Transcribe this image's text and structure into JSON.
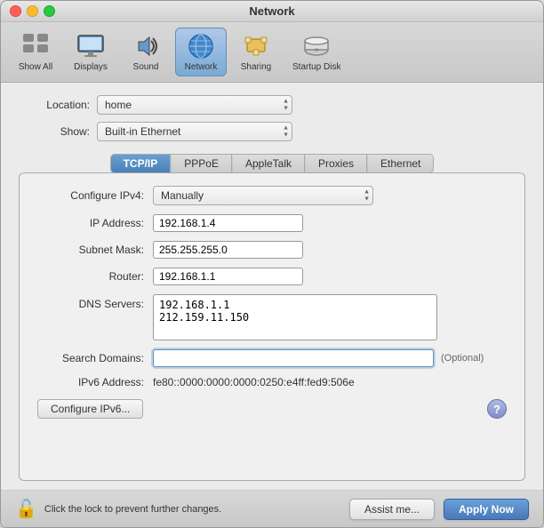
{
  "window": {
    "title": "Network"
  },
  "toolbar": {
    "items": [
      {
        "id": "show-all",
        "label": "Show All",
        "icon": "⊞"
      },
      {
        "id": "displays",
        "label": "Displays",
        "icon": "🖥"
      },
      {
        "id": "sound",
        "label": "Sound",
        "icon": "🔊"
      },
      {
        "id": "network",
        "label": "Network",
        "icon": "🌐",
        "active": true
      },
      {
        "id": "sharing",
        "label": "Sharing",
        "icon": "🤝"
      },
      {
        "id": "startup-disk",
        "label": "Startup Disk",
        "icon": "💿"
      }
    ]
  },
  "form": {
    "location_label": "Location:",
    "location_value": "home",
    "show_label": "Show:",
    "show_value": "Built-in Ethernet"
  },
  "tabs": [
    {
      "id": "tcp-ip",
      "label": "TCP/IP",
      "active": true
    },
    {
      "id": "pppoe",
      "label": "PPPoE",
      "active": false
    },
    {
      "id": "appletalk",
      "label": "AppleTalk",
      "active": false
    },
    {
      "id": "proxies",
      "label": "Proxies",
      "active": false
    },
    {
      "id": "ethernet",
      "label": "Ethernet",
      "active": false
    }
  ],
  "panel": {
    "configure_ipv4_label": "Configure IPv4:",
    "configure_ipv4_value": "Manually",
    "ip_address_label": "IP Address:",
    "ip_address_value": "192.168.1.4",
    "subnet_mask_label": "Subnet Mask:",
    "subnet_mask_value": "255.255.255.0",
    "router_label": "Router:",
    "router_value": "192.168.1.1",
    "dns_servers_label": "DNS Servers:",
    "dns_servers_value": "192.168.1.1\n212.159.11.150",
    "search_domains_label": "Search Domains:",
    "search_domains_placeholder": "",
    "search_domains_optional": "(Optional)",
    "ipv6_address_label": "IPv6 Address:",
    "ipv6_address_value": "fe80::0000:0000:0000:0250:e4ff:fed9:506e",
    "configure_ipv6_btn": "Configure IPv6...",
    "help_btn": "?"
  },
  "footer": {
    "lock_text": "Click the lock to prevent further changes.",
    "assist_btn": "Assist me...",
    "apply_btn": "Apply Now"
  }
}
